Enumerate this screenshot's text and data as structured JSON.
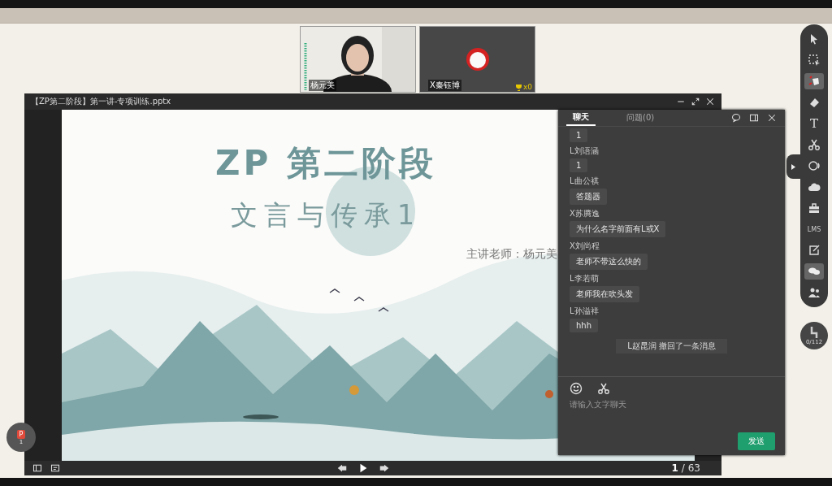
{
  "videos": [
    {
      "kind": "camera",
      "name": "杨元美"
    },
    {
      "kind": "avatar",
      "name": "X秦钰博",
      "trophies": "x0"
    }
  ],
  "presentation": {
    "title": "【ZP第二阶段】第一讲-专项训练.pptx",
    "slide": {
      "title": "ZP 第二阶段",
      "subtitle": "文言与传承1",
      "teacher": "主讲老师：杨元美"
    },
    "current": "1",
    "total": "/ 63"
  },
  "chat": {
    "tabs": [
      {
        "label": "聊天",
        "selected": true
      },
      {
        "label": "问题(0)",
        "selected": false
      }
    ],
    "messages": [
      {
        "kind": "message",
        "text": "1"
      },
      {
        "kind": "message",
        "sender": "L刘语涵",
        "text": "1"
      },
      {
        "kind": "message",
        "sender": "L曲公祺",
        "text": "答题器"
      },
      {
        "kind": "message",
        "sender": "X苏腾逸",
        "text": "为什么名字前面有L或X"
      },
      {
        "kind": "message",
        "sender": "X刘尚程",
        "text": "老师不带这么快的"
      },
      {
        "kind": "message",
        "sender": "L李若萌",
        "text": "老师我在吹头发"
      },
      {
        "kind": "message",
        "sender": "L孙溢祥",
        "text": "hhh"
      },
      {
        "kind": "notice",
        "text": "L赵昆润 撤回了一条消息"
      }
    ],
    "input": {
      "placeholder": "请输入文字聊天"
    },
    "send": "发送"
  },
  "tools": [
    {
      "kind": "pointer",
      "selected": false
    },
    {
      "kind": "select",
      "selected": false
    },
    {
      "kind": "pen",
      "selected": true
    },
    {
      "kind": "eraser",
      "selected": false
    },
    {
      "kind": "text",
      "label": "T",
      "selected": false
    },
    {
      "kind": "scissors",
      "selected": false
    },
    {
      "kind": "circle",
      "selected": false
    },
    {
      "kind": "cloud",
      "selected": false
    },
    {
      "kind": "toolbox",
      "selected": false
    },
    {
      "kind": "lms",
      "label": "LMS",
      "selected": false
    },
    {
      "kind": "edit",
      "selected": false
    },
    {
      "kind": "chat",
      "selected": true
    },
    {
      "kind": "users",
      "selected": false
    }
  ],
  "hand_raise": {
    "count": "0/112"
  },
  "file_badge": {
    "label": "P",
    "count": "1"
  }
}
